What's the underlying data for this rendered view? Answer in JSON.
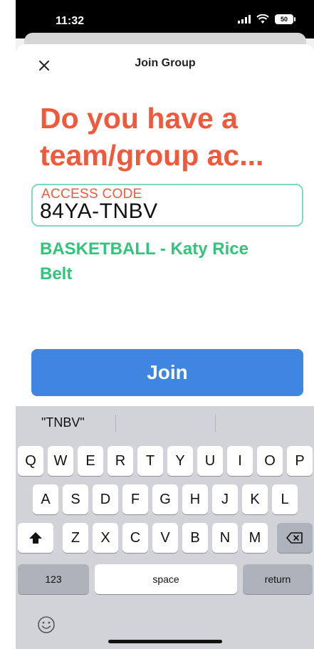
{
  "status_bar": {
    "time": "11:32",
    "battery": "50"
  },
  "header": {
    "title": "Join Group",
    "close_icon": "close-icon"
  },
  "headline": "Do you have a team/group ac...",
  "access_code": {
    "label": "ACCESS CODE",
    "value": "84YA-TNBV"
  },
  "group_name": "BASKETBALL - Katy Rice Belt",
  "join_button": "Join",
  "keyboard": {
    "suggestions": [
      "\"TNBV\"",
      "",
      ""
    ],
    "row1": [
      "Q",
      "W",
      "E",
      "R",
      "T",
      "Y",
      "U",
      "I",
      "O",
      "P"
    ],
    "row2": [
      "A",
      "S",
      "D",
      "F",
      "G",
      "H",
      "J",
      "K",
      "L"
    ],
    "row3": [
      "Z",
      "X",
      "C",
      "V",
      "B",
      "N",
      "M"
    ],
    "numbers_key": "123",
    "space_key": "space",
    "return_key": "return",
    "icons": {
      "shift": "shift-icon",
      "backspace": "backspace-icon",
      "emoji": "emoji-icon"
    }
  },
  "colors": {
    "accent": "#ef5a3d",
    "success": "#31c47a",
    "primary": "#3f86e0",
    "field_border": "#7fd8c0"
  }
}
